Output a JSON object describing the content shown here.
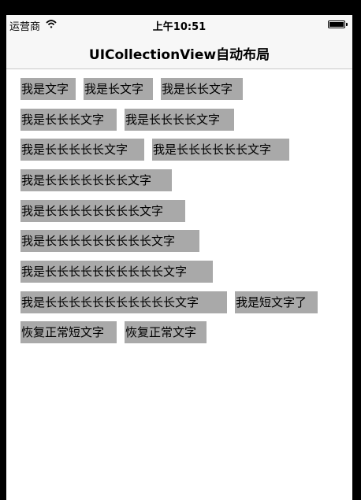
{
  "status_bar": {
    "carrier": "运营商",
    "time": "上午10:51"
  },
  "nav": {
    "title": "UICollectionView自动布局"
  },
  "cells": [
    "我是文字",
    "我是长文字",
    "我是长长文字",
    "我是长长长文字",
    "我是长长长长文字",
    "我是长长长长长文字",
    "我是长长长长长长文字",
    "我是长长长长长长长文字",
    "我是长长长长长长长长文字",
    "我是长长长长长长长长长文字",
    "我是长长长长长长长长长长文字",
    "我是长长长长长长长长长长长文字",
    "我是短文字了",
    "恢复正常短文字",
    "恢复正常文字"
  ]
}
